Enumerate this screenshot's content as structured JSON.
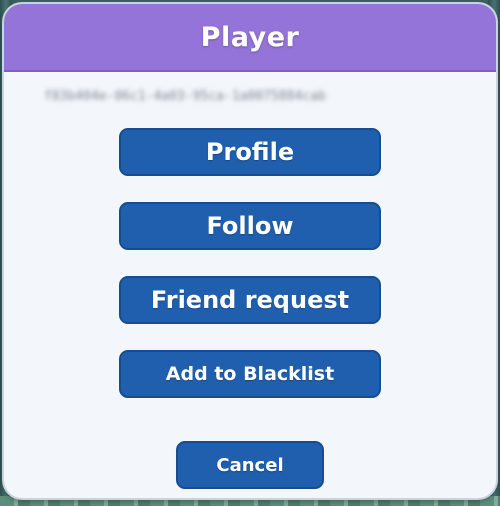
{
  "dialog": {
    "title": "Player",
    "player_id": "f83b404e-06c1-4a03-95ca-1a0075884cab"
  },
  "actions": {
    "profile_label": "Profile",
    "follow_label": "Follow",
    "friend_request_label": "Friend request",
    "blacklist_label": "Add to Blacklist",
    "cancel_label": "Cancel"
  },
  "colors": {
    "header": "#9474d8",
    "button": "#1f5fae",
    "dialog_background": "#f3f7fb"
  }
}
